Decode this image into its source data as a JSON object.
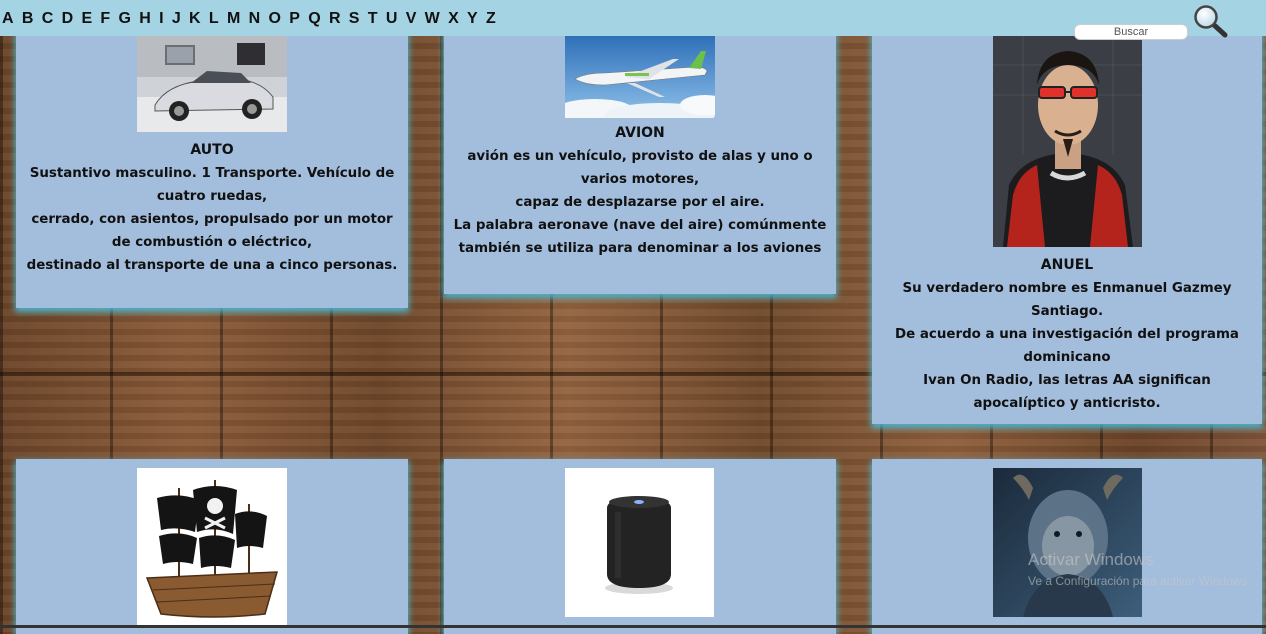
{
  "alphabet": [
    "A",
    "B",
    "C",
    "D",
    "E",
    "F",
    "G",
    "H",
    "I",
    "J",
    "K",
    "L",
    "M",
    "N",
    "O",
    "P",
    "Q",
    "R",
    "S",
    "T",
    "U",
    "V",
    "W",
    "X",
    "Y",
    "Z"
  ],
  "search": {
    "placeholder": "Buscar"
  },
  "cards": [
    {
      "word": "AUTO",
      "image": "silver-sports-car",
      "definition": "Sustantivo masculino. 1 Transporte. Vehículo de cuatro ruedas,\ncerrado, con asientos, propulsado por un motor de combustión o eléctrico,\ndestinado al transporte de una a cinco personas."
    },
    {
      "word": "AVION",
      "image": "airplane-above-clouds",
      "definition": "avión es un vehículo, provisto de alas y uno o varios motores,\ncapaz de desplazarse por el aire.\nLa palabra aeronave (nave del aire) comúnmente\ntambién se utiliza para denominar a los aviones"
    },
    {
      "word": "ANUEL",
      "image": "man-with-red-glasses",
      "definition": "Su verdadero nombre es Enmanuel Gazmey Santiago.\nDe acuerdo a una investigación del programa dominicano\nIvan On Radio, las letras AA significan apocalíptico y anticristo."
    },
    {
      "image": "pirate-ship"
    },
    {
      "image": "smart-speaker"
    },
    {
      "image": "beast-character"
    }
  ],
  "watermark": {
    "line1": "Activar Windows",
    "line2": "Ve a Configuración para activar Windows."
  },
  "colors": {
    "topbar": "#a4d4e3",
    "card": "#a3bddc",
    "card_glow": "#46bedc"
  }
}
